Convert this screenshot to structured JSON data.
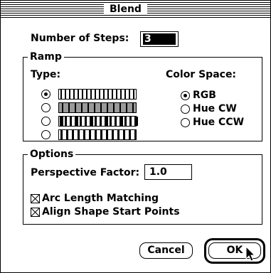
{
  "window": {
    "title": "Blend"
  },
  "steps": {
    "label": "Number of Steps:",
    "value": "3"
  },
  "ramp": {
    "group_label": "Ramp",
    "type_label": "Type:",
    "options": [
      {
        "selected": true
      },
      {
        "selected": false
      },
      {
        "selected": false
      },
      {
        "selected": false
      }
    ]
  },
  "color_space": {
    "label": "Color Space:",
    "options": [
      {
        "label": "RGB",
        "selected": true
      },
      {
        "label": "Hue CW",
        "selected": false
      },
      {
        "label": "Hue CCW",
        "selected": false
      }
    ]
  },
  "options": {
    "group_label": "Options",
    "perspective_label": "Perspective Factor:",
    "perspective_value": "1.0",
    "arc_length": {
      "label": "Arc Length Matching",
      "checked": true
    },
    "align_shape": {
      "label": "Align Shape Start Points",
      "checked": true
    }
  },
  "buttons": {
    "cancel": "Cancel",
    "ok": "OK"
  }
}
